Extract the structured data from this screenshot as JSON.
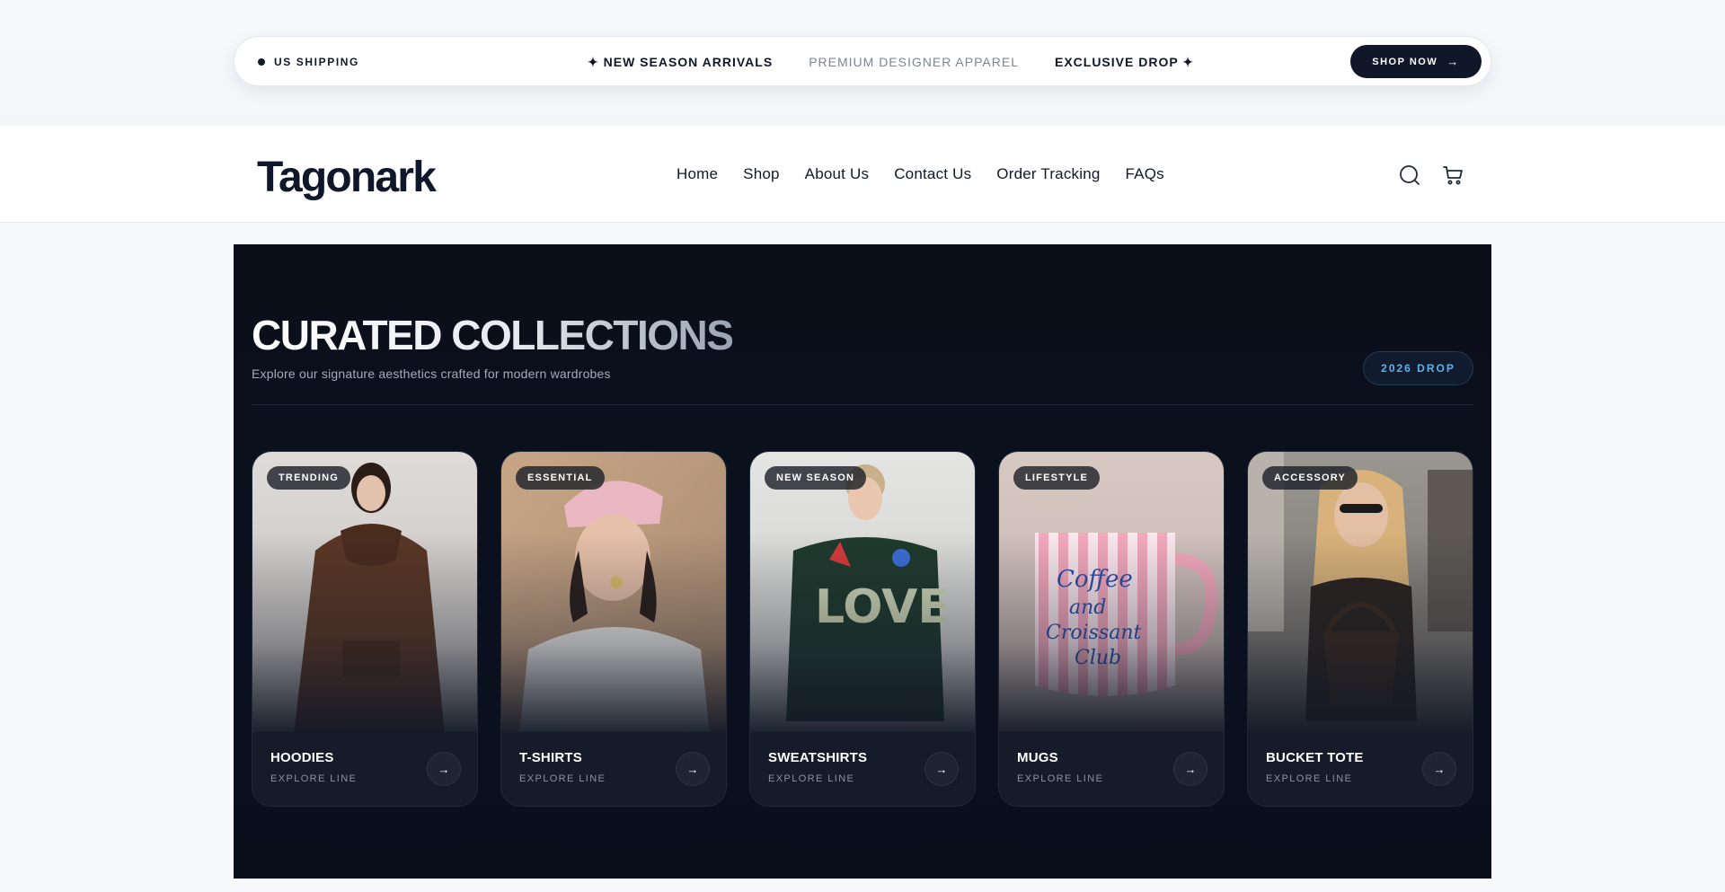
{
  "announcement": {
    "shipping_label": "US SHIPPING",
    "ticker": [
      "✦ NEW SEASON ARRIVALS",
      "PREMIUM DESIGNER APPAREL",
      "EXCLUSIVE DROP ✦"
    ],
    "cta_label": "SHOP NOW",
    "cta_arrow": "→"
  },
  "header": {
    "logo": "Tagonark",
    "nav": [
      "Home",
      "Shop",
      "About Us",
      "Contact Us",
      "Order Tracking",
      "FAQs"
    ],
    "icons": [
      "search-icon",
      "cart-icon"
    ]
  },
  "collections": {
    "title": "CURATED COLLECTIONS",
    "subtitle": "Explore our signature aesthetics crafted for modern wardrobes",
    "badge": "2026 DROP",
    "cards": [
      {
        "tag": "TRENDING",
        "name": "HOODIES",
        "sub": "EXPLORE LINE",
        "arrow": "→"
      },
      {
        "tag": "ESSENTIAL",
        "name": "T-SHIRTS",
        "sub": "EXPLORE LINE",
        "arrow": "→"
      },
      {
        "tag": "NEW SEASON",
        "name": "SWEATSHIRTS",
        "sub": "EXPLORE LINE",
        "arrow": "→"
      },
      {
        "tag": "LIFESTYLE",
        "name": "MUGS",
        "sub": "EXPLORE LINE",
        "arrow": "→"
      },
      {
        "tag": "ACCESSORY",
        "name": "BUCKET TOTE",
        "sub": "EXPLORE LINE",
        "arrow": "→"
      }
    ]
  },
  "colors": {
    "navy": "#0f1729",
    "panel": "#0b0f19",
    "badge_text": "#5fb0ea",
    "page_bg": "#f7f9fc"
  }
}
